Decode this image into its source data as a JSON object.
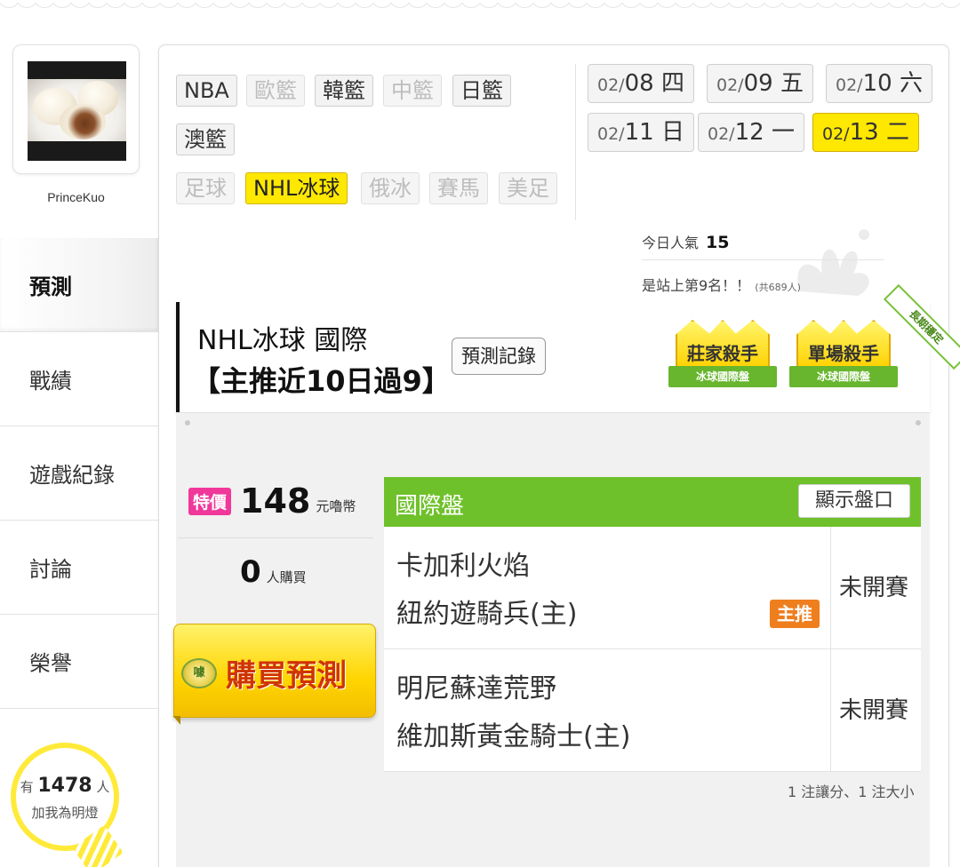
{
  "profile": {
    "username": "PrinceKuo",
    "fans_prefix": "有",
    "fans_count": "1478",
    "fans_suffix": "人",
    "fans_label": "加我為明燈"
  },
  "sidebar": {
    "items": [
      {
        "label": "預測",
        "active": true
      },
      {
        "label": "戰績",
        "active": false
      },
      {
        "label": "遊戲紀錄",
        "active": false
      },
      {
        "label": "討論",
        "active": false
      },
      {
        "label": "榮譽",
        "active": false
      }
    ]
  },
  "categories": [
    {
      "label": "NBA",
      "state": "normal"
    },
    {
      "label": "歐籃",
      "state": "dim"
    },
    {
      "label": "韓籃",
      "state": "normal"
    },
    {
      "label": "中籃",
      "state": "dim"
    },
    {
      "label": "日籃",
      "state": "normal"
    },
    {
      "label": "澳籃",
      "state": "normal"
    },
    {
      "label": "足球",
      "state": "dim"
    },
    {
      "label": "NHL冰球",
      "state": "selected"
    },
    {
      "label": "俄冰",
      "state": "dim"
    },
    {
      "label": "賽馬",
      "state": "dim"
    },
    {
      "label": "美足",
      "state": "dim"
    }
  ],
  "dates": [
    {
      "month": "02/",
      "day": "08",
      "weekday": "四",
      "selected": false
    },
    {
      "month": "02/",
      "day": "09",
      "weekday": "五",
      "selected": false
    },
    {
      "month": "02/",
      "day": "10",
      "weekday": "六",
      "selected": false
    },
    {
      "month": "02/",
      "day": "11",
      "weekday": "日",
      "selected": false
    },
    {
      "month": "02/",
      "day": "12",
      "weekday": "一",
      "selected": false
    },
    {
      "month": "02/",
      "day": "13",
      "weekday": "二",
      "selected": true
    }
  ],
  "popularity": {
    "label": "今日人氣",
    "value": "15",
    "rank_text": "是站上第9名！！",
    "total_text": "(共689人)"
  },
  "prediction": {
    "title": "NHL冰球 國際",
    "subtitle": "【主推近10日過9】",
    "history_button": "預測記錄",
    "awards": [
      {
        "title": "莊家殺手",
        "ribbon": "冰球國際盤"
      },
      {
        "title": "單場殺手",
        "ribbon": "冰球國際盤"
      }
    ],
    "corner_tag": "長期穩定"
  },
  "pricing": {
    "special_label": "特價",
    "price": "148",
    "unit": "元嚕幣",
    "buyers_count": "0",
    "buyers_label": "人購買",
    "buy_icon": "噱",
    "buy_button": "購買預測"
  },
  "market": {
    "title": "國際盤",
    "show_line_button": "顯示盤口",
    "games": [
      {
        "away": "卡加利火焰",
        "home": "紐約遊騎兵(主)",
        "status": "未開賽",
        "badge": "主推"
      },
      {
        "away": "明尼蘇達荒野",
        "home": "維加斯黃金騎士(主)",
        "status": "未開賽",
        "badge": ""
      }
    ],
    "footnote": "1 注讓分、1 注大小"
  },
  "colors": {
    "accent_yellow": "#ffe800",
    "market_green": "#6fc12b",
    "special_pink": "#f0379a",
    "badge_orange": "#ef7e1e",
    "buy_text_red": "#d03400"
  }
}
